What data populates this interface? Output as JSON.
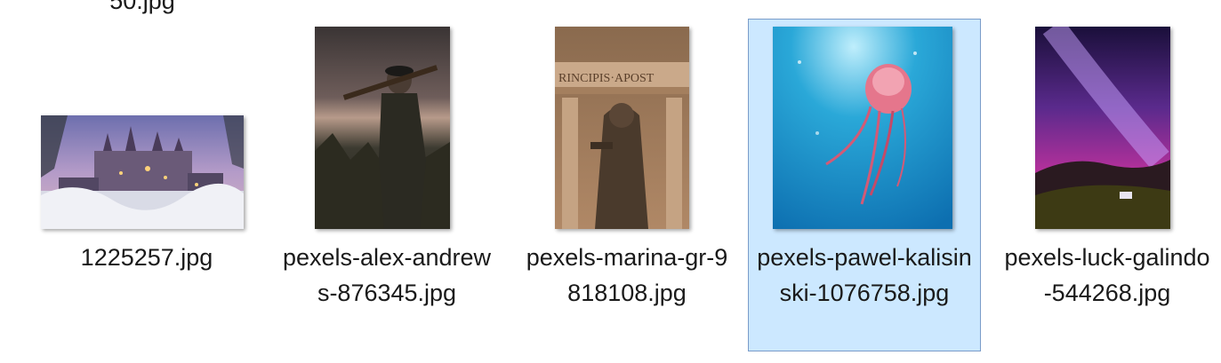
{
  "partial_row_label": "50.jpg",
  "files": [
    {
      "name": "1225257.jpg",
      "selected": false,
      "icon": "image-thumbnail-castle"
    },
    {
      "name": "pexels-alex-andrews-876345.jpg",
      "selected": false,
      "icon": "image-thumbnail-soldier"
    },
    {
      "name": "pexels-marina-gr-9818108.jpg",
      "selected": false,
      "icon": "image-thumbnail-statue"
    },
    {
      "name": "pexels-pawel-kalisinski-1076758.jpg",
      "selected": true,
      "icon": "image-thumbnail-jellyfish"
    },
    {
      "name": "pexels-luck-galindo-544268.jpg",
      "selected": false,
      "icon": "image-thumbnail-milkyway"
    }
  ],
  "colors": {
    "selection_fill": "#cce8ff",
    "selection_border": "#7a9cc9"
  }
}
